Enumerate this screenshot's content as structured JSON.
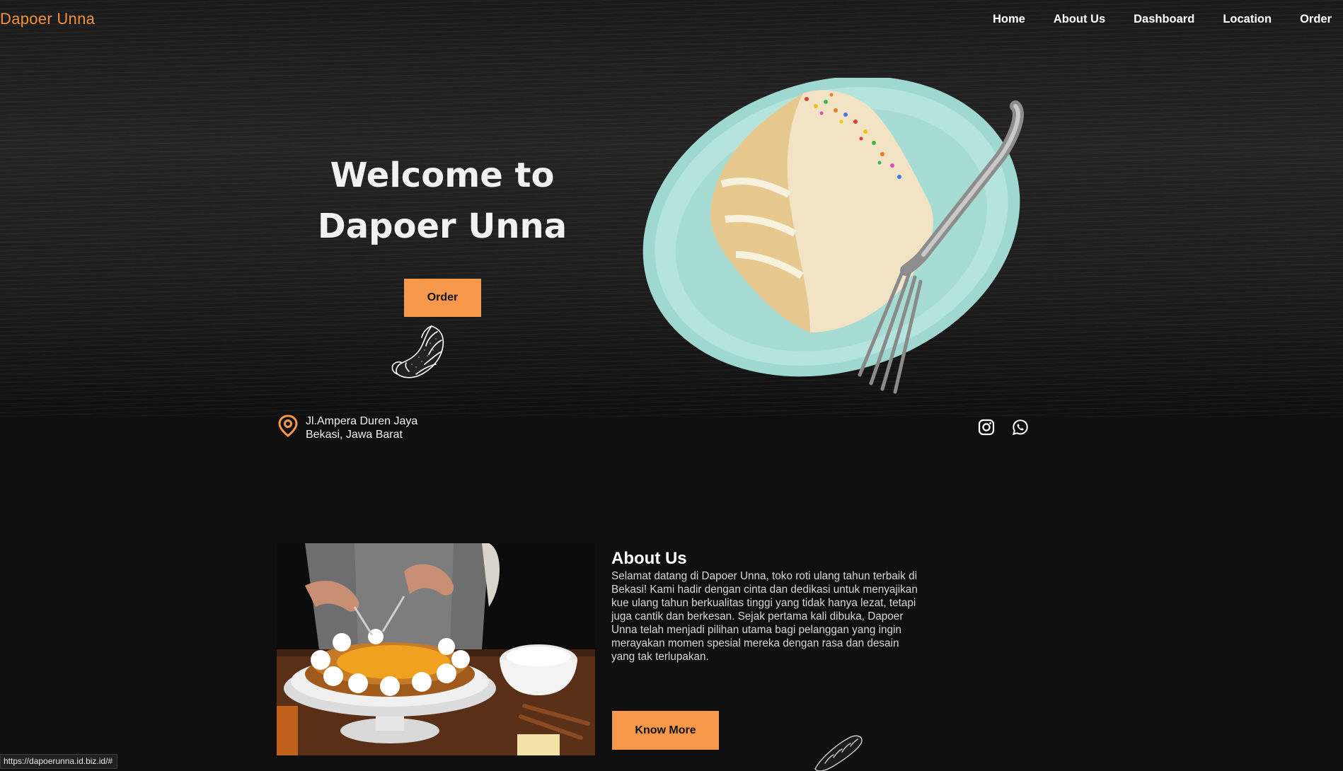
{
  "brand": "Dapoer Unna",
  "nav": {
    "home": "Home",
    "about": "About Us",
    "dashboard": "Dashboard",
    "location": "Location",
    "order": "Order"
  },
  "hero": {
    "title_line1": "Welcome to",
    "title_line2": "Dapoer Unna",
    "order_button": "Order"
  },
  "address": {
    "line1": "Jl.Ampera Duren Jaya",
    "line2": "Bekasi, Jawa Barat"
  },
  "social": {
    "icons": [
      "instagram-icon",
      "whatsapp-icon"
    ]
  },
  "about": {
    "heading": "About Us",
    "body": "Selamat datang di Dapoer Unna, toko roti ulang tahun terbaik di Bekasi! Kami hadir dengan cinta dan dedikasi untuk menyajikan kue ulang tahun berkualitas tinggi yang tidak hanya lezat, tetapi juga cantik dan berkesan. Sejak pertama kali dibuka, Dapoer Unna telah menjadi pilihan utama bagi pelanggan yang ingin merayakan momen spesial mereka dengan rasa dan desain yang tak terlupakan.",
    "button": "Know More"
  },
  "status_bar": {
    "url": "https://dapoerunna.id.biz.id/#"
  },
  "colors": {
    "accent": "#f5984a",
    "brand": "#f2913d",
    "background": "#0f0f0f",
    "text": "#ffffff"
  }
}
